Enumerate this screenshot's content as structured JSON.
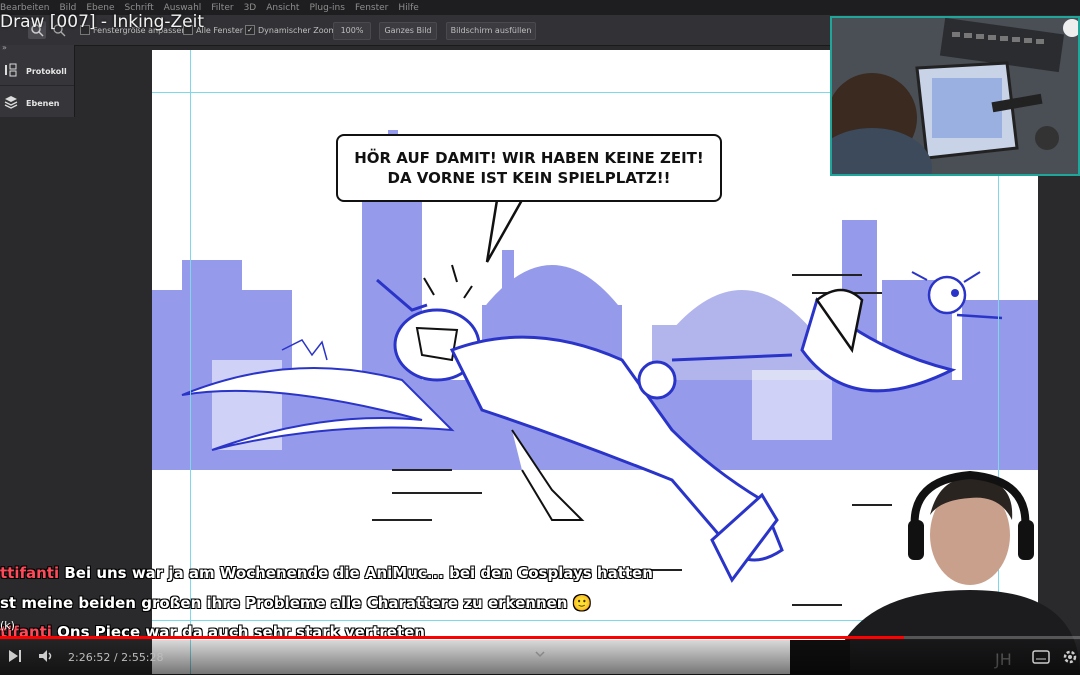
{
  "menu": [
    "Bearbeiten",
    "Bild",
    "Ebene",
    "Schrift",
    "Auswahl",
    "Filter",
    "3D",
    "Ansicht",
    "Plug-ins",
    "Fenster",
    "Hilfe"
  ],
  "stream_title": "Draw [007] - Inking-Zeit",
  "toolbar": {
    "fit_window_label": "Fenstergröße anpassen",
    "all_windows_label": "Alle Fenster",
    "dynamic_zoom_label": "Dynamischer Zoom",
    "zoom_value": "100%",
    "whole_image_label": "Ganzes Bild",
    "fill_screen_label": "Bildschirm ausfüllen"
  },
  "panels": [
    {
      "label": "Protokoll",
      "icon": "history-brush-icon"
    },
    {
      "label": "Ebenen",
      "icon": "layers-icon"
    }
  ],
  "speech_bubble": {
    "line1": "HÖR AUF DAMIT! WIR HABEN KEINE ZEIT!",
    "line2": "DA VORNE IST KEIN SPIELPLATZ!!"
  },
  "chat": [
    {
      "user": "ttifanti",
      "message": " Bei uns war ja am Wochenende die AniMuc... bei den Cosplays hatten"
    },
    {
      "user": "",
      "message": "st meine beiden großen ihre Probleme alle Charattere zu erkennen 🙂"
    },
    {
      "user": "tifanti",
      "message": " Ons Piece war da auch sehr stark vertreten"
    }
  ],
  "player": {
    "current_time": "2:26:52",
    "separator": " / ",
    "total_time": "2:55:28",
    "progress": 0.837,
    "badge": "(k)"
  },
  "colors": {
    "accent": "#1fa59a",
    "ink": "#2a34c8",
    "background_blue": "#8a90e8",
    "progress": "#ff0000",
    "chat_user": "#ff4a5a"
  }
}
